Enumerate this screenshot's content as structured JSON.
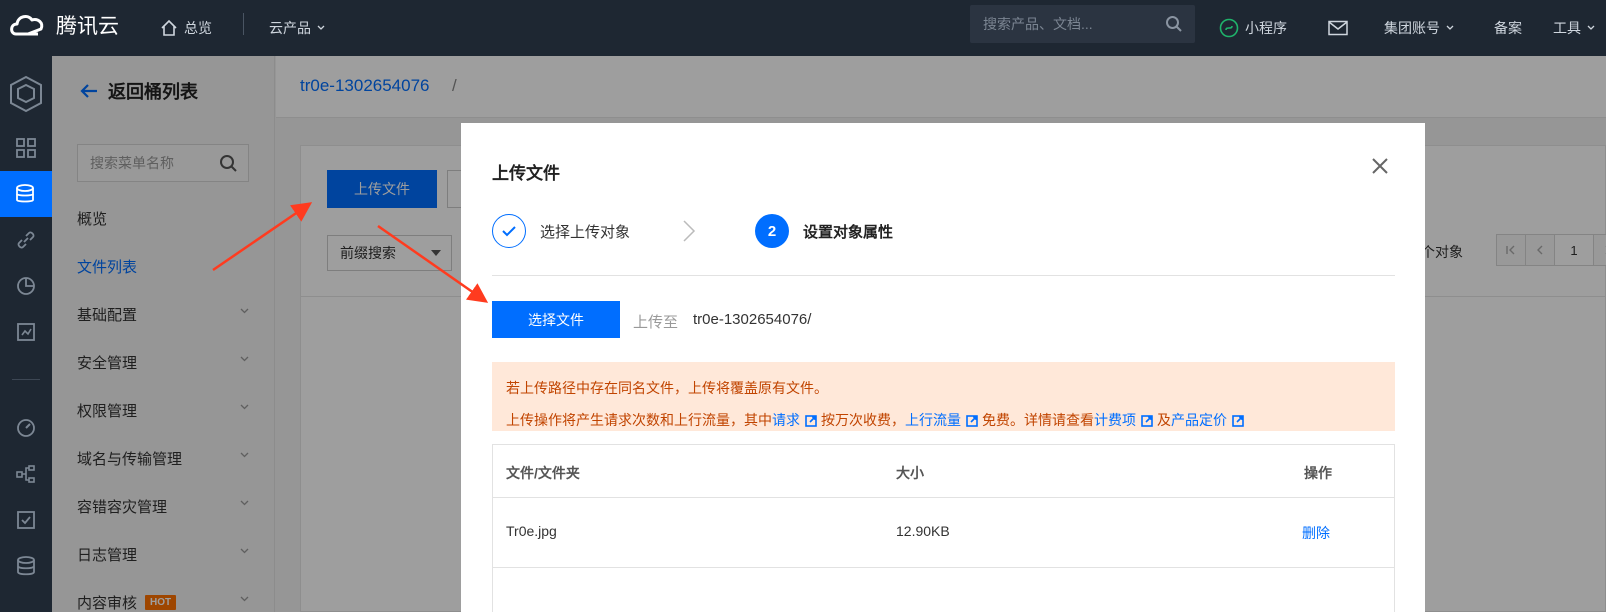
{
  "topbar": {
    "logo_text": "腾讯云",
    "overview": "总览",
    "cloud_products": "云产品",
    "search_placeholder": "搜索产品、文档...",
    "mini_program": "小程序",
    "group_account": "集团账号",
    "beian": "备案",
    "tools": "工具"
  },
  "sidebar": {
    "back_label": "返回桶列表",
    "search_placeholder": "搜索菜单名称",
    "items": [
      {
        "label": "概览"
      },
      {
        "label": "文件列表"
      },
      {
        "label": "基础配置"
      },
      {
        "label": "安全管理"
      },
      {
        "label": "权限管理"
      },
      {
        "label": "域名与传输管理"
      },
      {
        "label": "容错容灾管理"
      },
      {
        "label": "日志管理"
      },
      {
        "label": "内容审核"
      }
    ],
    "hot_badge": "HOT"
  },
  "main": {
    "bucket_name": "tr0e-1302654076",
    "crumb_sep": "/",
    "upload_button": "上传文件",
    "filter_select": "前缀搜索",
    "object_count_text": "个对象",
    "current_page": "1"
  },
  "modal": {
    "title": "上传文件",
    "steps": [
      {
        "label": "选择上传对象"
      },
      {
        "number": "2",
        "label": "设置对象属性"
      }
    ],
    "choose_file_button": "选择文件",
    "upload_to_label": "上传至",
    "upload_to_path": "tr0e-1302654076/",
    "notice_line1": "若上传路径中存在同名文件，上传将覆盖原有文件。",
    "notice_line2": {
      "p1": "上传操作将产生请求次数和上行流量，其中",
      "link_request": "请求",
      "p2": "按万次收费，",
      "link_traffic": "上行流量",
      "p3": "免费。详情请查看",
      "link_billing": "计费项",
      "p4": "及",
      "link_pricing": "产品定价"
    },
    "table": {
      "headers": [
        "文件/文件夹",
        "大小",
        "操作"
      ],
      "rows": [
        {
          "name": "Tr0e.jpg",
          "size": "12.90KB",
          "action": "删除"
        }
      ]
    }
  },
  "colors": {
    "primary": "#006eff",
    "topbar_bg": "#1e2732",
    "notice_bg": "#ffe8d9",
    "notice_text": "#c14400",
    "annotation_arrow": "#ff3b1f"
  }
}
